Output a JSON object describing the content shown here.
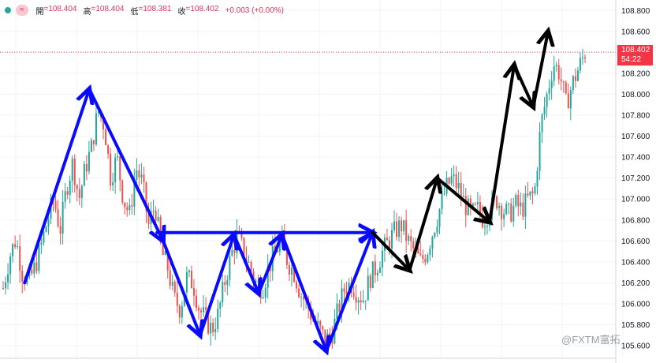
{
  "header": {
    "open_label": "開",
    "open_value": "=108.404",
    "high_label": "高",
    "high_value": "=108.404",
    "low_label": "低",
    "low_value": "=108.381",
    "close_label": "收",
    "close_value": "=108.402",
    "change": "+0.003 (+0.00%)",
    "pill_text": "≈"
  },
  "price_tag": {
    "price": "108.402",
    "countdown": "54:22"
  },
  "watermark": "@FXTM富拓",
  "colors": {
    "up": "#26a69a",
    "down": "#ef5350",
    "annot_blue": "#0a0aff",
    "annot_black": "#000000",
    "last_price": "#f23645"
  },
  "chart_data": {
    "type": "candlestick",
    "y_ticks": [
      "108.800",
      "108.600",
      "108.200",
      "108.000",
      "107.800",
      "107.600",
      "107.400",
      "107.200",
      "107.000",
      "106.800",
      "106.600",
      "106.400",
      "106.200",
      "106.000",
      "105.800",
      "105.600"
    ],
    "ylim": [
      105.48,
      108.9
    ],
    "last_price": 108.402,
    "candles_path": [
      106.15,
      106.45,
      106.62,
      106.3,
      106.2,
      106.35,
      106.55,
      106.8,
      107.0,
      106.7,
      107.1,
      107.35,
      107.0,
      107.3,
      107.5,
      107.85,
      107.7,
      107.2,
      107.4,
      107.0,
      106.85,
      107.3,
      107.15,
      106.75,
      106.95,
      106.5,
      106.35,
      106.05,
      105.95,
      106.25,
      106.2,
      105.95,
      105.85,
      105.75,
      105.9,
      106.2,
      106.45,
      106.65,
      106.5,
      106.35,
      106.2,
      106.15,
      106.35,
      106.5,
      106.6,
      106.4,
      106.3,
      106.1,
      106.0,
      105.85,
      105.75,
      105.65,
      105.72,
      105.95,
      106.15,
      106.2,
      106.1,
      106.05,
      106.25,
      106.35,
      106.5,
      106.6,
      106.7,
      106.75,
      106.6,
      106.5,
      106.4,
      106.5,
      106.7,
      106.9,
      107.1,
      107.2,
      107.1,
      106.95,
      106.85,
      106.9,
      106.8,
      106.9,
      107.0,
      106.9,
      106.85,
      106.95,
      106.9,
      107.0,
      107.05,
      107.7,
      108.0,
      108.3,
      108.2,
      107.9,
      108.1,
      108.25,
      108.4
    ],
    "annotations": [
      {
        "color": "blue",
        "points": [
          [
            106.2,
            0.04
          ],
          [
            108.05,
            0.145
          ]
        ]
      },
      {
        "color": "blue",
        "points": [
          [
            108.05,
            0.145
          ],
          [
            106.6,
            0.265
          ]
        ]
      },
      {
        "color": "blue",
        "points": [
          [
            106.6,
            0.265
          ],
          [
            105.7,
            0.325
          ]
        ]
      },
      {
        "color": "blue",
        "points": [
          [
            105.7,
            0.325
          ],
          [
            106.66,
            0.38
          ]
        ]
      },
      {
        "color": "blue",
        "points": [
          [
            106.66,
            0.38
          ],
          [
            106.1,
            0.42
          ]
        ]
      },
      {
        "color": "blue",
        "points": [
          [
            106.1,
            0.42
          ],
          [
            106.66,
            0.458
          ]
        ]
      },
      {
        "color": "blue",
        "points": [
          [
            106.66,
            0.458
          ],
          [
            105.55,
            0.53
          ]
        ]
      },
      {
        "color": "blue",
        "points": [
          [
            105.55,
            0.53
          ],
          [
            106.68,
            0.605
          ]
        ]
      },
      {
        "color": "blue",
        "points": [
          [
            106.68,
            0.255
          ],
          [
            106.68,
            0.605
          ]
        ]
      },
      {
        "color": "black",
        "points": [
          [
            106.68,
            0.605
          ],
          [
            106.32,
            0.665
          ]
        ]
      },
      {
        "color": "black",
        "points": [
          [
            106.32,
            0.665
          ],
          [
            107.2,
            0.71
          ]
        ]
      },
      {
        "color": "black",
        "points": [
          [
            107.2,
            0.71
          ],
          [
            106.78,
            0.795
          ]
        ]
      },
      {
        "color": "black",
        "points": [
          [
            106.78,
            0.795
          ],
          [
            108.28,
            0.835
          ]
        ]
      },
      {
        "color": "black",
        "points": [
          [
            108.28,
            0.835
          ],
          [
            107.88,
            0.866
          ]
        ]
      },
      {
        "color": "black",
        "points": [
          [
            107.88,
            0.866
          ],
          [
            108.6,
            0.89
          ]
        ]
      }
    ]
  }
}
